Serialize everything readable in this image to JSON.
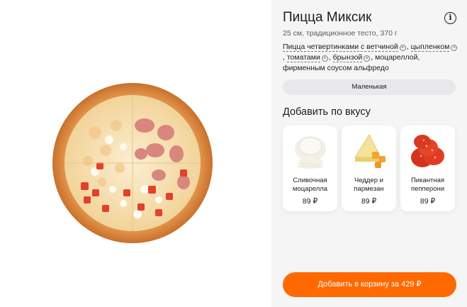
{
  "product": {
    "title": "Пицца Миксик",
    "info_icon": "info-icon",
    "subtitle": "25 см, традиционное тесто, 370 г",
    "image_icon": "pizza-image",
    "ingredients": {
      "removable_1": "Пицца четвертинками с ветчиной",
      "sep_1": ", ",
      "removable_2": "цыпленком",
      "sep_2": ", ",
      "removable_3": "томатами",
      "sep_3": ", ",
      "removable_4": "брынзой",
      "rest": ", моцареллой, фирменным соусом альфредо",
      "remove_glyph": "×"
    }
  },
  "size": {
    "selected": "Маленькая"
  },
  "toppings": {
    "title": "Добавить по вкусу",
    "items": [
      {
        "name": "Сливочная моцарелла",
        "price": "89 ₽",
        "icon": "mozzarella-icon"
      },
      {
        "name": "Чеддер и пармезан",
        "price": "89 ₽",
        "icon": "cheese-icon"
      },
      {
        "name": "Пикантная пепперони",
        "price": "89 ₽",
        "icon": "pepperoni-icon"
      }
    ]
  },
  "cart": {
    "button_label": "Добавить в корзину за 429 ₽"
  },
  "colors": {
    "accent": "#ff6900",
    "panel_bg": "#f5f5f5",
    "card_bg": "#ffffff"
  }
}
